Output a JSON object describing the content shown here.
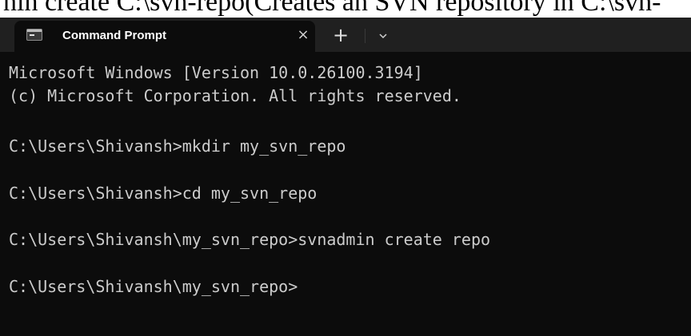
{
  "document": {
    "caption_fragment": "nin create C:\\svn-repo(Creates an SVN repository in C:\\svn-"
  },
  "window": {
    "tab_title": "Command Prompt",
    "close_glyph": "×",
    "new_tab_glyph": "+"
  },
  "console": {
    "lines": [
      "Microsoft Windows [Version 10.0.26100.3194]",
      "(c) Microsoft Corporation. All rights reserved.",
      "C:\\Users\\Shivansh>mkdir my_svn_repo",
      "C:\\Users\\Shivansh>cd my_svn_repo",
      "C:\\Users\\Shivansh\\my_svn_repo>svnadmin create repo",
      "C:\\Users\\Shivansh\\my_svn_repo>"
    ]
  },
  "colors": {
    "terminal_bg": "#0c0c0c",
    "titlebar_bg": "#202020",
    "text": "#cccccc"
  }
}
